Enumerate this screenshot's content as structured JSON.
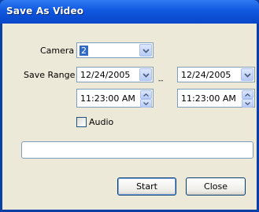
{
  "window": {
    "title": "Save As Video"
  },
  "form": {
    "camera_label": "Camera",
    "camera_value": "2",
    "save_range_label": "Save Range",
    "start_date": "12/24/2005",
    "end_date": "12/24/2005",
    "range_separator": "--",
    "start_time": "11:23:00 AM",
    "end_time": "11:23:00 AM",
    "audio_label": "Audio",
    "audio_checked": false
  },
  "progress": {
    "value": 0
  },
  "buttons": {
    "start": "Start",
    "close": "Close"
  },
  "colors": {
    "titlebar": "#0846c8",
    "client": "#ece9d8",
    "selection": "#316ac5"
  }
}
